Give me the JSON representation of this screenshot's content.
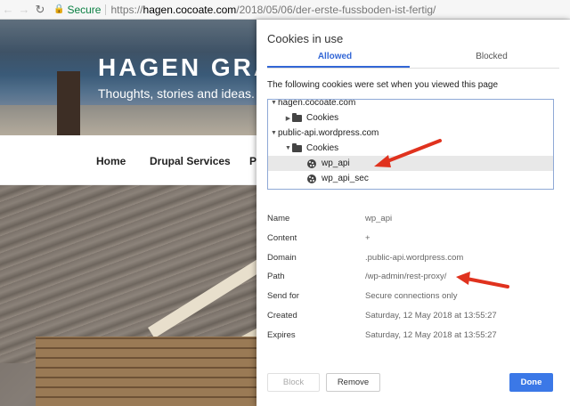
{
  "browser": {
    "secure_label": "Secure",
    "url_scheme": "https://",
    "url_host": "hagen.cocoate.com",
    "url_path": "/2018/05/06/der-erste-fussboden-ist-fertig/"
  },
  "site": {
    "title": "HAGEN GRA",
    "tagline": "Thoughts, stories and ideas.",
    "nav": [
      "Home",
      "Drupal Services",
      "P"
    ]
  },
  "dialog": {
    "title": "Cookies in use",
    "tabs": {
      "allowed": "Allowed",
      "blocked": "Blocked"
    },
    "intro": "The following cookies were set when you viewed this page",
    "tree": [
      {
        "label": "hagen.cocoate.com",
        "type": "domain",
        "expanded": true
      },
      {
        "label": "Cookies",
        "type": "folder",
        "expanded": false
      },
      {
        "label": "public-api.wordpress.com",
        "type": "domain",
        "expanded": true
      },
      {
        "label": "Cookies",
        "type": "folder",
        "expanded": true
      },
      {
        "label": "wp_api",
        "type": "cookie",
        "selected": true
      },
      {
        "label": "wp_api_sec",
        "type": "cookie",
        "selected": false
      }
    ],
    "details": [
      {
        "key": "Name",
        "value": "wp_api"
      },
      {
        "key": "Content",
        "value": "+"
      },
      {
        "key": "Domain",
        "value": ".public-api.wordpress.com"
      },
      {
        "key": "Path",
        "value": "/wp-admin/rest-proxy/"
      },
      {
        "key": "Send for",
        "value": "Secure connections only"
      },
      {
        "key": "Created",
        "value": "Saturday, 12 May 2018 at 13:55:27"
      },
      {
        "key": "Expires",
        "value": "Saturday, 12 May 2018 at 13:55:27"
      }
    ],
    "buttons": {
      "block": "Block",
      "remove": "Remove",
      "done": "Done"
    }
  },
  "colors": {
    "accent": "#3367d6",
    "secure": "#0b8043",
    "annotation_arrow": "#e0321e"
  }
}
